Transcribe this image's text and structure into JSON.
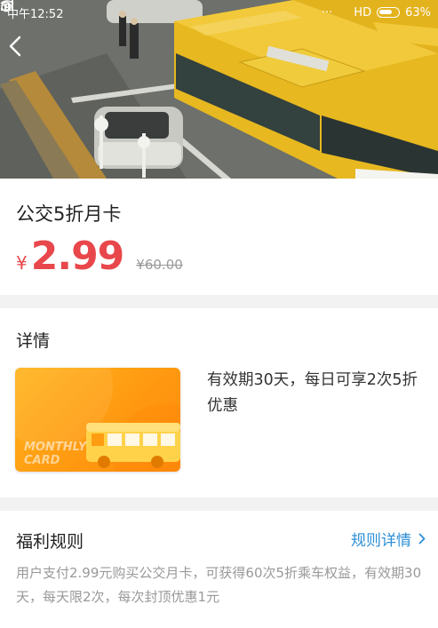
{
  "status_bar": {
    "time": "中午12:52",
    "signal_label": "HD",
    "battery": "63%"
  },
  "product": {
    "title": "公交5折月卡",
    "currency_symbol": "¥",
    "price": "2.99",
    "original_price": "¥60.00"
  },
  "details": {
    "heading": "详情",
    "card_text_line1": "MONTHLY",
    "card_text_line2": "CARD",
    "description": "有效期30天，每日可享2次5折优惠"
  },
  "rules": {
    "heading": "福利规则",
    "link_label": "规则详情",
    "body": "用户支付2.99元购买公交月卡，可获得60次5折乘车权益，有效期30天，每天限2次，每次封顶优惠1元"
  },
  "colors": {
    "price": "#e8474b",
    "link": "#2d8fd6",
    "card": "#ff9a11",
    "divider": "#f2f2f2"
  },
  "icons": {
    "back": "chevron-left-icon",
    "rules_link": "chevron-right-icon"
  }
}
